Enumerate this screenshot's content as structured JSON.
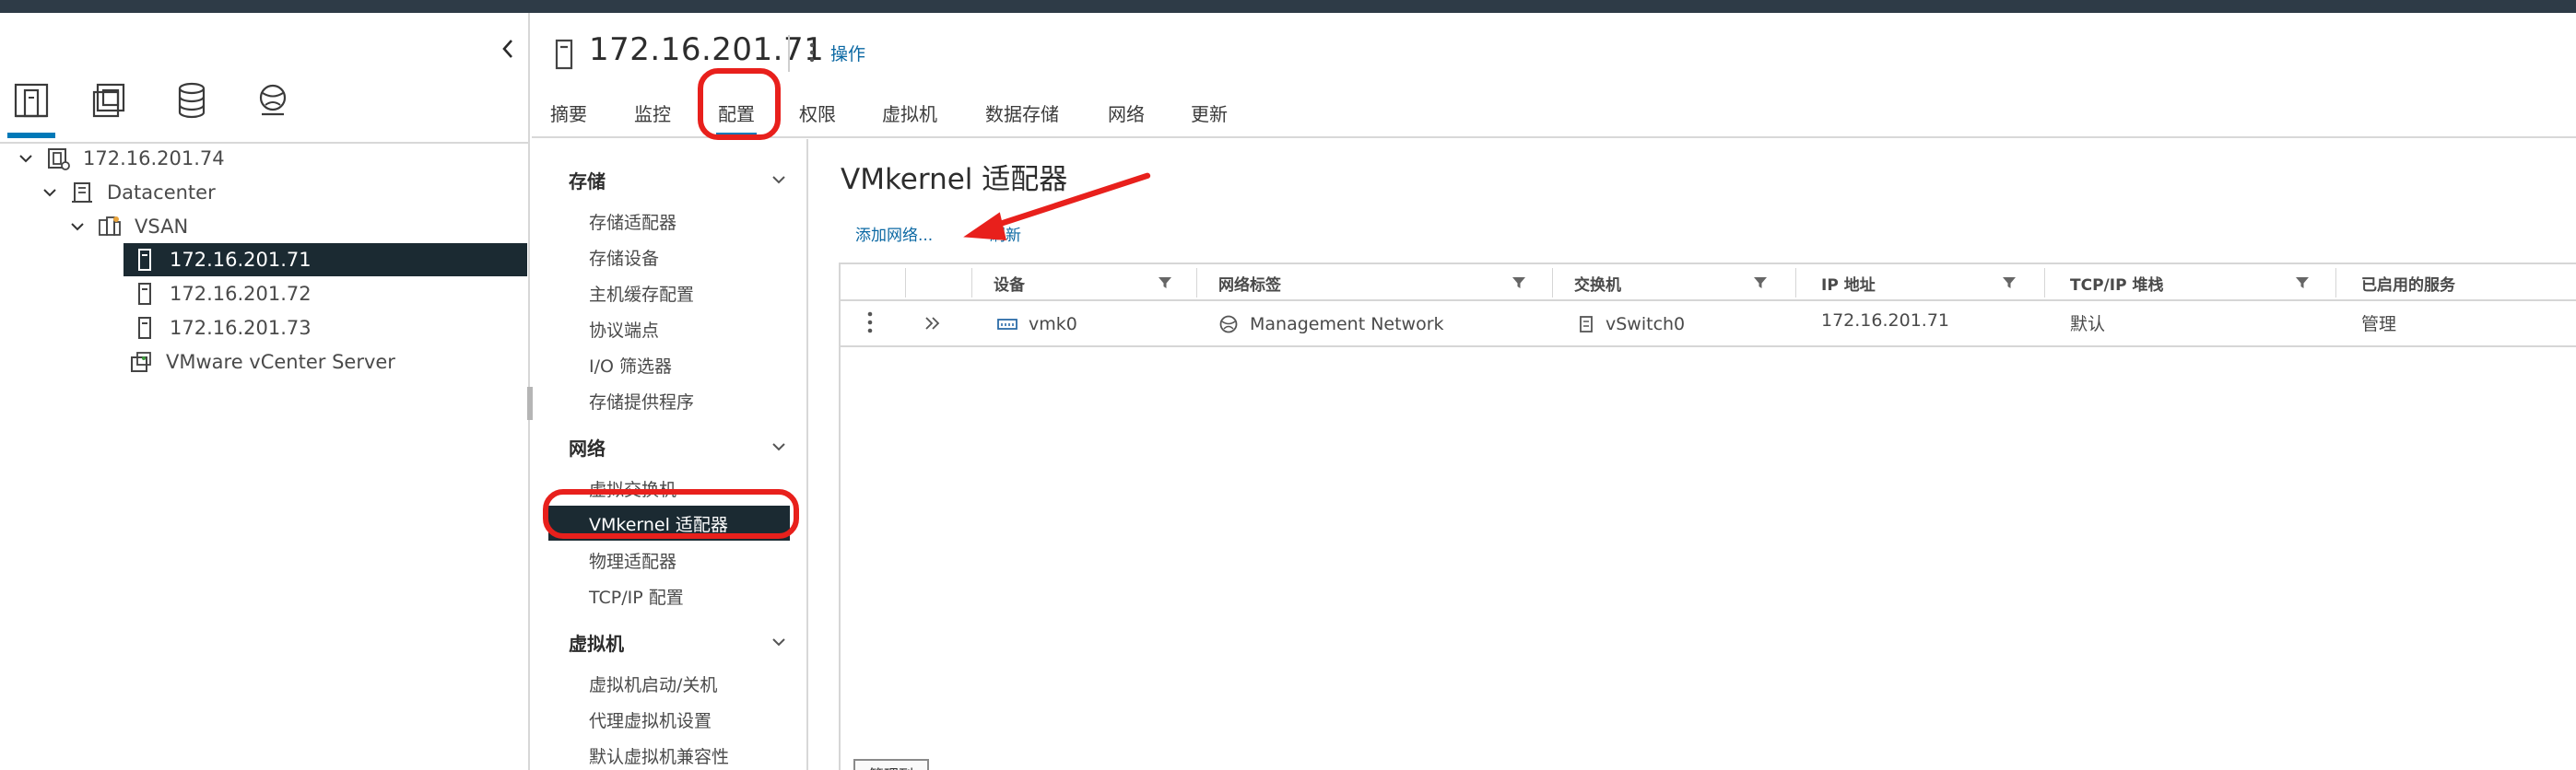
{
  "host": {
    "title": "172.16.201.71",
    "actions_label": "操作"
  },
  "tabs": [
    {
      "label": "摘要"
    },
    {
      "label": "监控"
    },
    {
      "label": "配置"
    },
    {
      "label": "权限"
    },
    {
      "label": "虚拟机"
    },
    {
      "label": "数据存储"
    },
    {
      "label": "网络"
    },
    {
      "label": "更新"
    }
  ],
  "tree": {
    "vcenter": "172.16.201.74",
    "datacenter": "Datacenter",
    "cluster": "VSAN",
    "host1": "172.16.201.71",
    "host2": "172.16.201.72",
    "host3": "172.16.201.73",
    "vcsa": "VMware vCenter Server"
  },
  "submenu": {
    "storage": {
      "title": "存储",
      "items": [
        "存储适配器",
        "存储设备",
        "主机缓存配置",
        "协议端点",
        "I/O 筛选器",
        "存储提供程序"
      ]
    },
    "network": {
      "title": "网络",
      "items": [
        "虚拟交换机",
        "VMkernel 适配器",
        "物理适配器",
        "TCP/IP 配置"
      ]
    },
    "vm": {
      "title": "虚拟机",
      "items": [
        "虚拟机启动/关机",
        "代理虚拟机设置",
        "默认虚拟机兼容性"
      ]
    }
  },
  "content": {
    "title": "VMkernel 适配器",
    "add_network": "添加网络...",
    "refresh": "刷新",
    "columns": [
      "设备",
      "网络标签",
      "交换机",
      "IP 地址",
      "TCP/IP 堆栈",
      "已启用的服务"
    ],
    "rows": [
      {
        "device": "vmk0",
        "network_label": "Management Network",
        "switch": "vSwitch0",
        "ip": "172.16.201.71",
        "tcpip": "默认",
        "services": "管理"
      }
    ],
    "manage_columns": "管理列"
  },
  "colors": {
    "accent": "#0079b8",
    "selected_bg": "#1b2a32",
    "annotation": "#e8201c",
    "link": "#0b68a3"
  }
}
